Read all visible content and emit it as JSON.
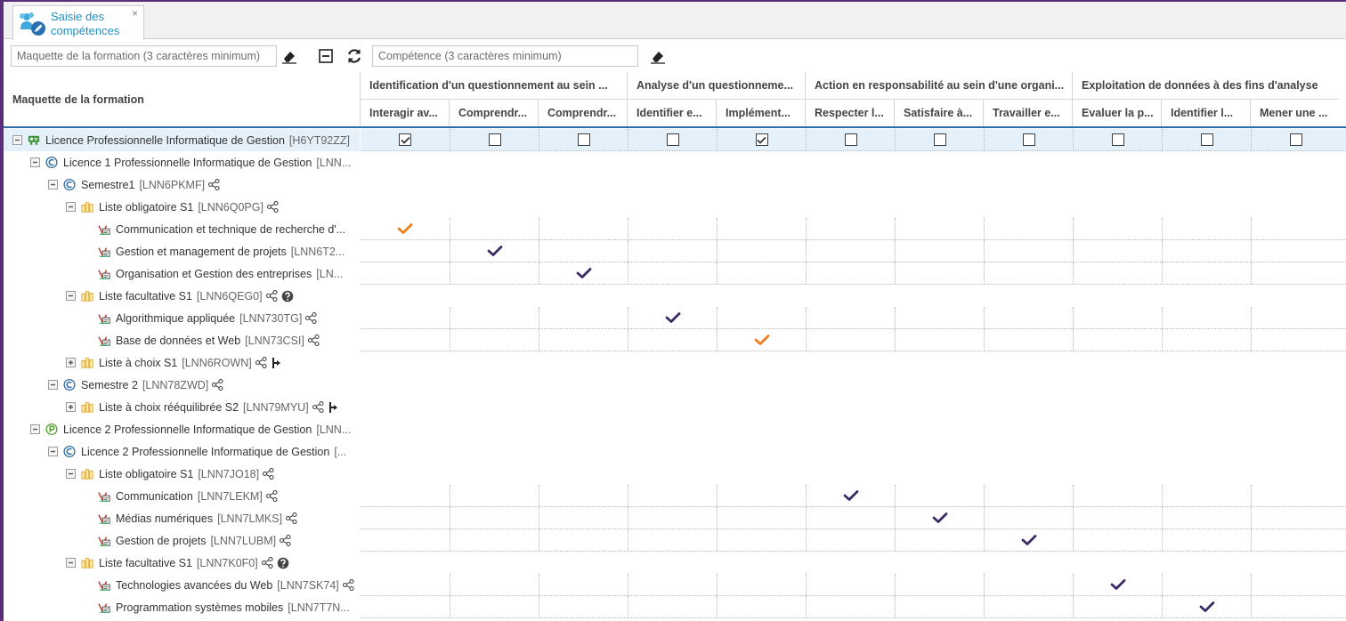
{
  "tab": {
    "label": "Saisie des compétences",
    "close": "×"
  },
  "toolbar": {
    "formation_search_placeholder": "Maquette de la formation (3 caractères minimum)",
    "competence_search_placeholder": "Compétence (3 caractères minimum)"
  },
  "tree_header": "Maquette de la formation",
  "colors": {
    "accent": "#1f8fc0",
    "frame": "#5b2e7c",
    "check_dark": "#3b2a63",
    "check_orange": "#f07c1b",
    "header_line": "#2f6fa6",
    "row_highlight": "#e4f0fa"
  },
  "groups": [
    {
      "label": "Identification d'un questionnement au sein ...",
      "span": 3
    },
    {
      "label": "Analyse d'un questionneme...",
      "span": 2
    },
    {
      "label": "Action en responsabilité au sein d'une organi...",
      "span": 3
    },
    {
      "label": "Exploitation de données à des fins d'analyse",
      "span": 3
    }
  ],
  "competences": [
    "Interagir av...",
    "Comprendr...",
    "Comprendr...",
    "Identifier e...",
    "Implément...",
    "Respecter l...",
    "Satisfaire à...",
    "Travailler e...",
    "Evaluer la p...",
    "Identifier l...",
    "Mener une ..."
  ],
  "rows": [
    {
      "level": 0,
      "toggle": "minus",
      "icon": "diploma-icon",
      "label": "Licence Professionnelle Informatique de Gestion",
      "code": "[H6YT92ZZ]",
      "share": false,
      "extra": "",
      "highlight": true,
      "checkbox": [
        true,
        false,
        false,
        false,
        true,
        false,
        false,
        false,
        false,
        false,
        false
      ]
    },
    {
      "level": 1,
      "toggle": "minus",
      "icon": "c-circle-icon",
      "label": "Licence 1 Professionnelle Informatique de Gestion",
      "code": "[LNN...",
      "share": false,
      "extra": ""
    },
    {
      "level": 2,
      "toggle": "minus",
      "icon": "c-circle-icon",
      "label": "Semestre1",
      "code": "[LNN6PKMF]",
      "share": true,
      "extra": ""
    },
    {
      "level": 3,
      "toggle": "minus",
      "icon": "folder-list-icon",
      "label": "Liste obligatoire S1",
      "code": "[LNN6Q0PG]",
      "share": true,
      "extra": ""
    },
    {
      "level": 4,
      "toggle": "none",
      "icon": "course-icon",
      "label": "Communication et technique de recherche d'...",
      "code": "",
      "share": false,
      "extra": "",
      "grid": true,
      "check": 0,
      "check_color": "orange"
    },
    {
      "level": 4,
      "toggle": "none",
      "icon": "course-icon",
      "label": "Gestion et management de projets",
      "code": "[LNN6T2...",
      "share": false,
      "extra": "",
      "grid": true,
      "check": 1,
      "check_color": "dark"
    },
    {
      "level": 4,
      "toggle": "none",
      "icon": "course-icon",
      "label": "Organisation et Gestion des entreprises",
      "code": "[LN...",
      "share": false,
      "extra": "",
      "grid": true,
      "check": 2,
      "check_color": "dark"
    },
    {
      "level": 3,
      "toggle": "minus",
      "icon": "folder-list-icon",
      "label": "Liste facultative S1",
      "code": "[LNN6QEG0]",
      "share": true,
      "extra": "question"
    },
    {
      "level": 4,
      "toggle": "none",
      "icon": "course-icon",
      "label": "Algorithmique appliquée",
      "code": "[LNN730TG]",
      "share": true,
      "extra": "",
      "grid": true,
      "check": 3,
      "check_color": "dark"
    },
    {
      "level": 4,
      "toggle": "none",
      "icon": "course-icon",
      "label": "Base de données et Web",
      "code": "[LNN73CSI]",
      "share": true,
      "extra": "",
      "grid": true,
      "check": 4,
      "check_color": "orange"
    },
    {
      "level": 3,
      "toggle": "plus",
      "icon": "folder-list-icon",
      "label": "Liste à choix S1",
      "code": "[LNN6ROWN]",
      "share": true,
      "extra": "branch"
    },
    {
      "level": 2,
      "toggle": "minus",
      "icon": "c-circle-icon",
      "label": "Semestre 2",
      "code": "[LNN78ZWD]",
      "share": true,
      "extra": ""
    },
    {
      "level": 3,
      "toggle": "plus",
      "icon": "folder-list-icon",
      "label": "Liste à choix rééquilibrée S2",
      "code": "[LNN79MYU]",
      "share": true,
      "extra": "branch"
    },
    {
      "level": 1,
      "toggle": "minus",
      "icon": "p-circle-icon",
      "label": "Licence 2 Professionnelle Informatique de Gestion",
      "code": "[LNN...",
      "share": false,
      "extra": ""
    },
    {
      "level": 2,
      "toggle": "minus",
      "icon": "c-circle-icon",
      "label": "Licence 2 Professionnelle Informatique de Gestion",
      "code": "[...",
      "share": false,
      "extra": ""
    },
    {
      "level": 3,
      "toggle": "minus",
      "icon": "folder-list-icon",
      "label": "Liste obligatoire S1",
      "code": "[LNN7JO18]",
      "share": true,
      "extra": ""
    },
    {
      "level": 4,
      "toggle": "none",
      "icon": "course-icon",
      "label": "Communication",
      "code": "[LNN7LEKM]",
      "share": true,
      "extra": "",
      "grid": true,
      "check": 5,
      "check_color": "dark"
    },
    {
      "level": 4,
      "toggle": "none",
      "icon": "course-icon",
      "label": "Médias numériques",
      "code": "[LNN7LMKS]",
      "share": true,
      "extra": "",
      "grid": true,
      "check": 6,
      "check_color": "dark"
    },
    {
      "level": 4,
      "toggle": "none",
      "icon": "course-icon",
      "label": "Gestion de projets",
      "code": "[LNN7LUBM]",
      "share": true,
      "extra": "",
      "grid": true,
      "check": 7,
      "check_color": "dark"
    },
    {
      "level": 3,
      "toggle": "minus",
      "icon": "folder-list-icon",
      "label": "Liste facultative S1",
      "code": "[LNN7K0F0]",
      "share": true,
      "extra": "question"
    },
    {
      "level": 4,
      "toggle": "none",
      "icon": "course-icon",
      "label": "Technologies avancées du Web",
      "code": "[LNN7SK74]",
      "share": true,
      "extra": "",
      "grid": true,
      "check": 8,
      "check_color": "dark"
    },
    {
      "level": 4,
      "toggle": "none",
      "icon": "course-icon",
      "label": "Programmation systèmes mobiles",
      "code": "[LNN7T7N...",
      "share": false,
      "extra": "",
      "grid": true,
      "check": 9,
      "check_color": "dark"
    }
  ]
}
